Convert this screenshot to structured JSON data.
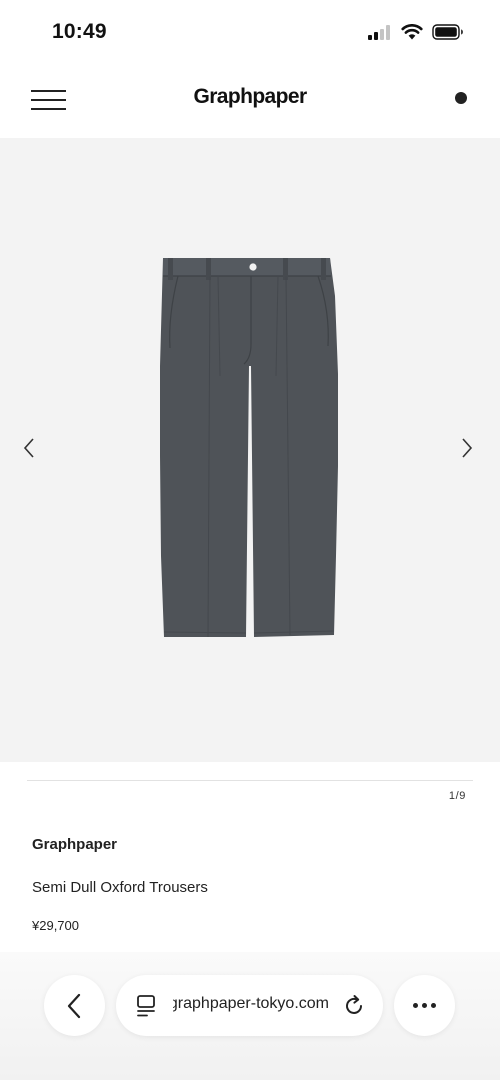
{
  "status_bar": {
    "time": "10:49",
    "icons": [
      "cellular-signal-icon",
      "wifi-icon",
      "battery-icon"
    ]
  },
  "header": {
    "brand": "Graphpaper",
    "menu_icon": "hamburger-menu-icon",
    "cart_icon": "cart-dot-icon"
  },
  "gallery": {
    "prev_icon": "chevron-left-icon",
    "next_icon": "chevron-right-icon",
    "current": 1,
    "total": 9,
    "counter": "1/9",
    "background": "#f3f3f3",
    "product_color": "#4f5358"
  },
  "product": {
    "brand": "Graphpaper",
    "name": "Semi Dull Oxford Trousers",
    "price": "¥29,700"
  },
  "browser": {
    "url": "graphpaper-tokyo.com",
    "back_icon": "chevron-left-icon",
    "tabs_icon": "tab-overview-icon",
    "reload_icon": "reload-icon",
    "more_icon": "more-dots-icon"
  }
}
